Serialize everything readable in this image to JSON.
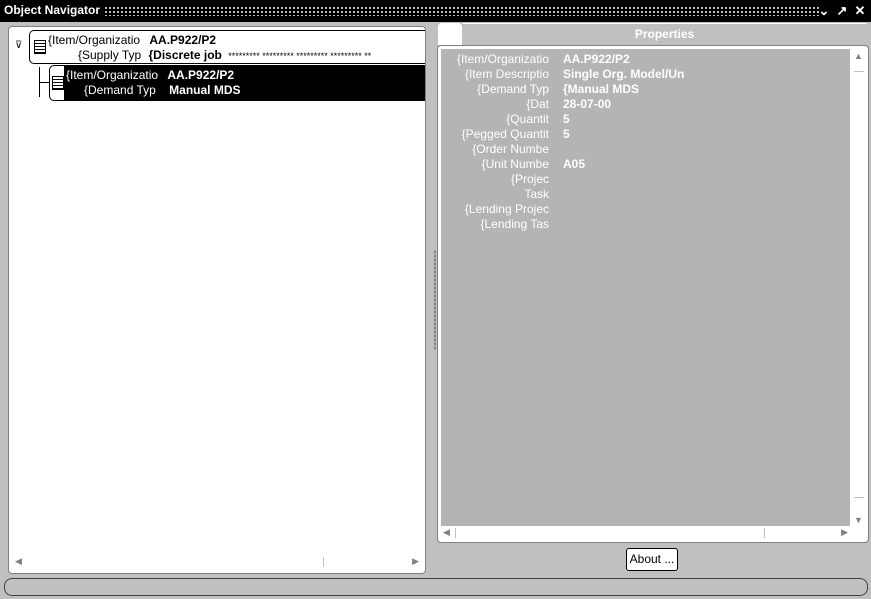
{
  "window": {
    "title": "Object Navigator"
  },
  "controls": {
    "minimize": "⌄",
    "maximize": "↗",
    "close": "✕"
  },
  "tree": {
    "node1": {
      "row1_label": "{Item/Organizatio",
      "row1_value": "AA.P922/P2",
      "row2_label": "{Supply Typ",
      "row2_value": "{Discrete job",
      "row2_extra": "********* ********* ********* ********* **"
    },
    "node2": {
      "row1_label": "{Item/Organizatio",
      "row1_value": "AA.P922/P2",
      "row2_label": "{Demand Typ",
      "row2_value": "Manual MDS"
    }
  },
  "properties": {
    "tab_label": "Properties",
    "rows": [
      {
        "label": "{Item/Organizatio",
        "value": "AA.P922/P2"
      },
      {
        "label": "{Item Descriptio",
        "value": "Single Org. Model/Un"
      },
      {
        "label": "{Demand Typ",
        "value": "{Manual MDS"
      },
      {
        "label": "{Dat",
        "value": "28-07-00"
      },
      {
        "label": "{Quantit",
        "value": "5"
      },
      {
        "label": "{Pegged Quantit",
        "value": "5"
      },
      {
        "label": "{Order Numbe",
        "value": ""
      },
      {
        "label": "{Unit Numbe",
        "value": "A05"
      },
      {
        "label": "{Projec",
        "value": ""
      },
      {
        "label": "Task",
        "value": ""
      },
      {
        "label": "{Lending Projec",
        "value": ""
      },
      {
        "label": "{Lending Tas",
        "value": ""
      }
    ]
  },
  "about_button": {
    "label": "About ..."
  },
  "icons": {
    "expand": "expand-collapse-icon",
    "node": "tree-node-icon",
    "scroll_left": "arrow-left-icon",
    "scroll_right": "arrow-right-icon",
    "scroll_up": "arrow-up-icon",
    "scroll_down": "arrow-down-icon"
  }
}
